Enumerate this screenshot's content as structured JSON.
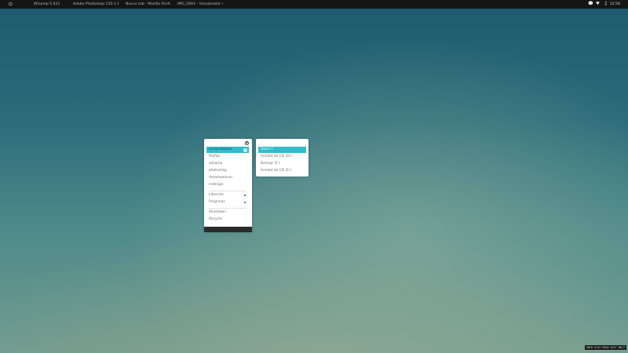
{
  "panel": {
    "logo_icon": "power-icon",
    "tasks": [
      "Winamp 5.621",
      "Adobe Photoshop CS5.1 Exte...",
      "Nuevo tab - Mozilla Firefox...",
      "IMG_5693 - Visualizador de f..."
    ],
    "tray_icons": [
      "chat-icon",
      "heart-icon",
      "music-icon"
    ],
    "tray_glyphs": [
      "💬",
      "♥",
      "♫"
    ],
    "clock": "12:56"
  },
  "menu": {
    "items": [
      {
        "label": "computadora",
        "active": true
      },
      {
        "label": "firefox"
      },
      {
        "label": "winamp"
      },
      {
        "label": "photoshop"
      },
      {
        "label": "dreamweaver"
      },
      {
        "label": "indesign"
      }
    ],
    "sub_items": [
      {
        "label": "Librerias",
        "arrow": "▶"
      },
      {
        "label": "Progrmas",
        "arrow": "▶"
      }
    ],
    "system_items": [
      {
        "label": "Shutdown"
      },
      {
        "label": "Recycle"
      }
    ],
    "add_glyph": "+"
  },
  "submenu": {
    "items": [
      {
        "label": "Disco C",
        "active": true
      },
      {
        "label": "Unidad de CD (D:)"
      },
      {
        "label": "Backup (F:)"
      },
      {
        "label": "Unidad de CD (E:)"
      }
    ]
  },
  "hint": "ENCD PLAY HOLD EXIT BELT",
  "colors": {
    "accent": "#32bccd",
    "panel_bg": "#151515"
  }
}
